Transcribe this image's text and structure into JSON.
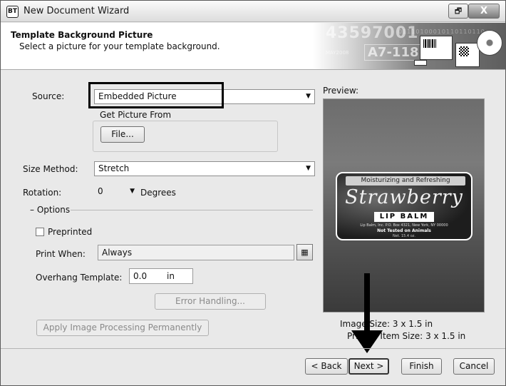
{
  "window": {
    "title": "New Document Wizard",
    "app_icon_text": "BT",
    "restore_glyph": "🗗",
    "close_glyph": "X"
  },
  "header": {
    "title": "Template Background Picture",
    "subtitle": "Select a picture for your template background.",
    "banner_number": "43597001",
    "banner_bits": "01110100010110110110",
    "banner_code": "A7-118",
    "banner_small": "MAY2008"
  },
  "form": {
    "source_label": "Source:",
    "source_value": "Embedded Picture",
    "get_picture_group": "Get Picture From",
    "file_button": "File...",
    "size_method_label": "Size Method:",
    "size_method_value": "Stretch",
    "rotation_label": "Rotation:",
    "rotation_value": "0",
    "rotation_unit": "Degrees",
    "options_label": "Options",
    "preprinted_label": "Preprinted",
    "preprinted_checked": false,
    "print_when_label": "Print When:",
    "print_when_value": "Always",
    "overhang_label": "Overhang Template:",
    "overhang_value": "0.0",
    "overhang_unit": "in",
    "error_handling_button": "Error Handling...",
    "apply_processing_button": "Apply Image Processing Permanently"
  },
  "preview": {
    "label": "Preview:",
    "sample_label": {
      "tagline": "Moisturizing and Refreshing",
      "name": "Strawberry",
      "product": "LIP BALM",
      "address": "Lip Balm, Inc. P.O. Box 4321, New York, NY 00000",
      "note": "Not Tested on Animals",
      "weight": "Net. 15.4 oz."
    },
    "image_size_label": "Image Size:",
    "image_size_value": "3 x 1.5 in",
    "printed_item_label": "Printed Item Size:",
    "printed_item_value": "3 x 1.5 in"
  },
  "buttons": {
    "back": "< Back",
    "next": "Next >",
    "finish": "Finish",
    "cancel": "Cancel"
  }
}
